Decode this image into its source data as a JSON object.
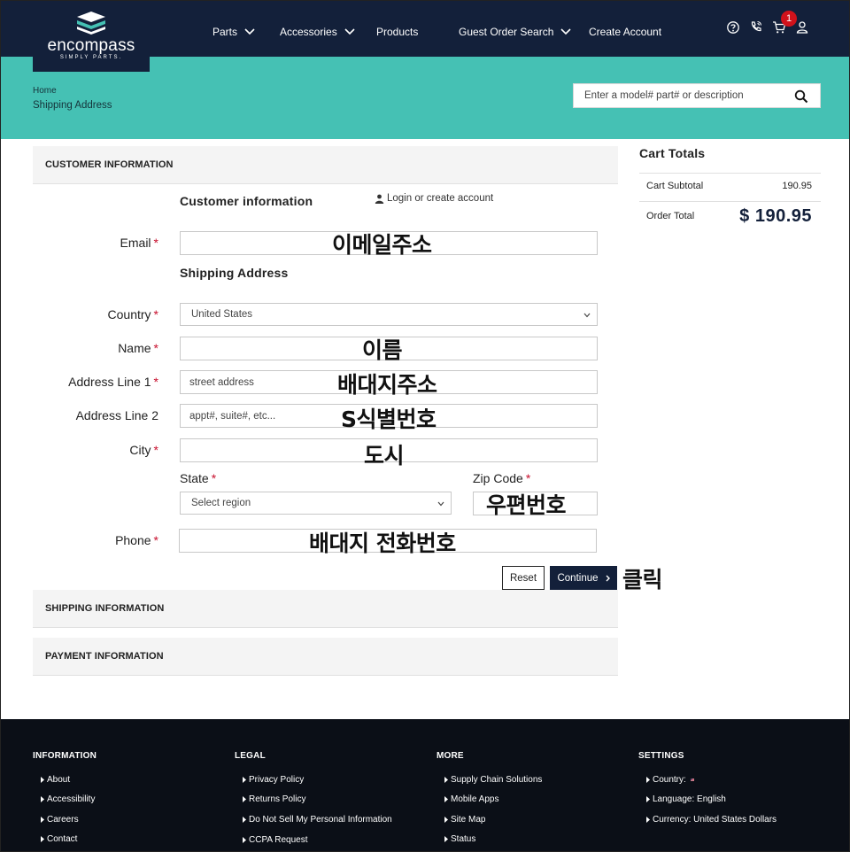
{
  "header": {
    "logo_text": "encompass",
    "logo_tagline": "SIMPLY PARTS.",
    "nav": [
      {
        "label": "Parts"
      },
      {
        "label": "Accessories"
      },
      {
        "label": "Products"
      },
      {
        "label": "Guest Order Search"
      },
      {
        "label": "Create Account"
      }
    ],
    "cart_count": "1",
    "icons": [
      "help-icon",
      "phone-icon",
      "cart-icon",
      "user-icon"
    ]
  },
  "breadcrumb": {
    "home": "Home",
    "current": "Shipping Address"
  },
  "search": {
    "placeholder": "Enter a model# part# or description"
  },
  "checkout": {
    "sections": {
      "customer": "CUSTOMER INFORMATION",
      "shipping": "SHIPPING INFORMATION",
      "payment": "PAYMENT INFORMATION"
    },
    "customer_info_title": "Customer information",
    "login_link": "Login or create account",
    "shipping_address_title": "Shipping Address",
    "labels": {
      "email": "Email",
      "country": "Country",
      "name": "Name",
      "address1": "Address Line 1",
      "address2": "Address Line 2",
      "city": "City",
      "state": "State",
      "zip": "Zip Code",
      "phone": "Phone"
    },
    "required_mark": "*",
    "country_value": "United States",
    "state_placeholder": "Select region",
    "address1_placeholder": "street address",
    "address2_placeholder": "appt#, suite#, etc...",
    "buttons": {
      "reset": "Reset",
      "continue": "Continue"
    }
  },
  "annotations": {
    "email": "이메일주소",
    "name": "이름",
    "address1": "배대지주소",
    "address2": "S식별번호",
    "city": "도시",
    "zip": "우편번호",
    "phone": "배대지 전화번호",
    "click": "클릭"
  },
  "cart": {
    "title": "Cart Totals",
    "subtotal_label": "Cart Subtotal",
    "subtotal_value": "190.95",
    "total_label": "Order Total",
    "total_value": "$ 190.95"
  },
  "footer": {
    "columns": [
      {
        "title": "INFORMATION",
        "links": [
          "About",
          "Accessibility",
          "Careers",
          "Contact"
        ]
      },
      {
        "title": "LEGAL",
        "links": [
          "Privacy Policy",
          "Returns Policy",
          "Do Not Sell My Personal Information",
          "CCPA Request"
        ]
      },
      {
        "title": "MORE",
        "links": [
          "Supply Chain Solutions",
          "Mobile Apps",
          "Site Map",
          "Status"
        ]
      },
      {
        "title": "SETTINGS",
        "links": [
          "Country:",
          "Language: English",
          "Currency: United States Dollars"
        ]
      }
    ]
  },
  "colors": {
    "navy": "#13203a",
    "teal": "#45c1b4",
    "required": "#c8102e",
    "badge": "#d0121b",
    "footer": "#0b0f17"
  }
}
